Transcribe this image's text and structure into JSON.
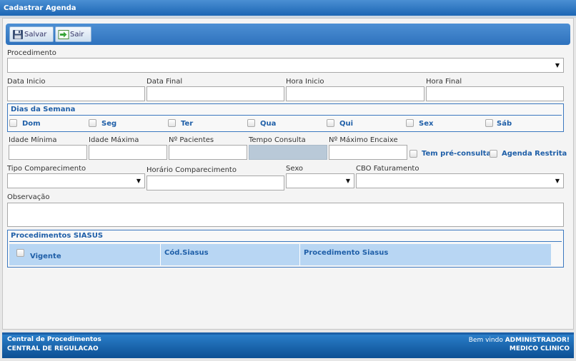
{
  "window": {
    "title": "Cadastrar Agenda"
  },
  "toolbar": {
    "save_label": "Salvar",
    "exit_label": "Sair"
  },
  "form": {
    "procedimento_label": "Procedimento",
    "procedimento_value": "",
    "data_inicio_label": "Data Inicio",
    "data_final_label": "Data Final",
    "hora_inicio_label": "Hora Inicio",
    "hora_final_label": "Hora Final",
    "dias_legend": "Dias da Semana",
    "days": [
      "Dom",
      "Seg",
      "Ter",
      "Qua",
      "Qui",
      "Sex",
      "Sáb"
    ],
    "idade_minima_label": "Idade Mínima",
    "idade_maxima_label": "Idade Máxima",
    "num_pacientes_label": "Nº Pacientes",
    "tempo_consulta_label": "Tempo Consulta",
    "max_encaixe_label": "Nº Máximo Encaixe",
    "pre_consulta_label": "Tem pré-consulta",
    "agenda_restrita_label": "Agenda Restrita",
    "tipo_comparecimento_label": "Tipo Comparecimento",
    "horario_comparecimento_label": "Horário Comparecimento",
    "sexo_label": "Sexo",
    "cbo_label": "CBO Faturamento",
    "observacao_label": "Observação"
  },
  "siasus": {
    "legend": "Procedimentos SIASUS",
    "columns": [
      "Vigente",
      "Cód.Siasus",
      "Procedimento Siasus"
    ]
  },
  "footer": {
    "line1": "Central de Procedimentos",
    "line2": "CENTRAL DE REGULACAO",
    "welcome_prefix": "Bem vindo",
    "user": "ADMINISTRADOR!",
    "role": "MEDICO CLINICO"
  },
  "colors": {
    "accent": "#1f5fa8",
    "header": "#2e72bd",
    "grid_header": "#b8d6f3"
  }
}
